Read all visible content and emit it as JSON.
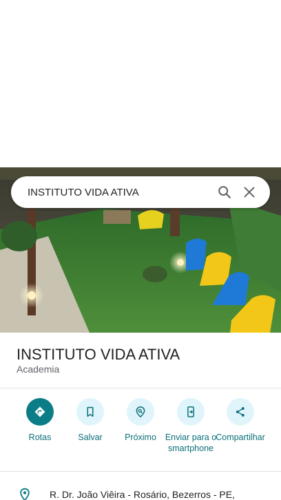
{
  "search": {
    "query": "INSTITUTO VIDA ATIVA",
    "icons": [
      "search-icon",
      "close-icon"
    ]
  },
  "place": {
    "name": "INSTITUTO VIDA ATIVA",
    "category": "Academia"
  },
  "actions": [
    {
      "label": "Rotas",
      "icon": "directions-icon"
    },
    {
      "label": "Salvar",
      "icon": "bookmark-icon"
    },
    {
      "label": "Próximo",
      "icon": "nearby-icon"
    },
    {
      "label": "Enviar para o smartphone",
      "icon": "send-to-phone-icon"
    },
    {
      "label": "Compartilhar",
      "icon": "share-icon"
    }
  ],
  "address": {
    "text": "R. Dr. João Viêira - Rosário, Bezerros - PE,",
    "icon": "location-pin-icon"
  },
  "colors": {
    "accent": "#0b7d86",
    "accent_light": "#e0f5fb",
    "action_text": "#0b6f79"
  }
}
